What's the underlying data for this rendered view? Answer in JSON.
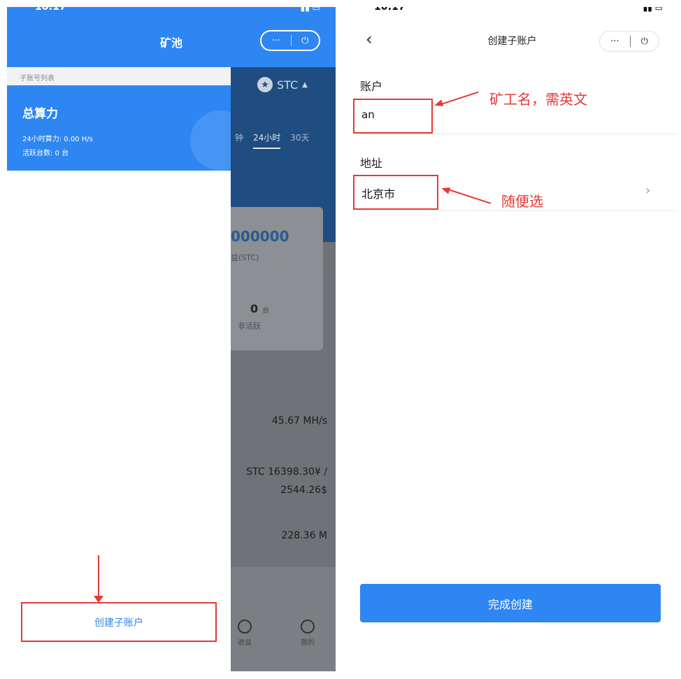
{
  "left": {
    "status_time": "10:17",
    "header_title": "矿池",
    "capsule_more": "···",
    "capsule_power": "⏻",
    "drawer": {
      "list_title": "子账号列表",
      "total_title": "总算力",
      "hashrate_24h": "24小时算力: 0.00 H/s",
      "active_devices": "活跃台数: 0 台",
      "create_button": "创建子账户"
    },
    "background": {
      "coin": "STC",
      "coin_icon": "★",
      "coin_caret": "▲",
      "tabs": [
        "钟",
        "24小时",
        "30天"
      ],
      "balance": "000000",
      "balance_label": "益(STC)",
      "inactive_value": "0",
      "inactive_unit": "台",
      "inactive_label": "非活跃",
      "network_hashrate": "45.67 MH/s",
      "price_line1": "STC 16398.30¥ /",
      "price_line2": "2544.26$",
      "difficulty": "228.36 M",
      "nav_income": "收益",
      "nav_mine": "我的"
    }
  },
  "right": {
    "status_time": "10:17",
    "title": "创建子账户",
    "back_icon": "‹",
    "capsule_more": "···",
    "capsule_power": "⏻",
    "account_label": "账户",
    "account_value": "an",
    "address_label": "地址",
    "address_value": "北京市",
    "address_chevron": "›",
    "annotation_account": "矿工名，需英文",
    "annotation_address": "随便选",
    "finish_button": "完成创建"
  },
  "colors": {
    "primary": "#2d86f2",
    "annotation_red": "#e53935",
    "overlay_gray": "#6f7378"
  }
}
